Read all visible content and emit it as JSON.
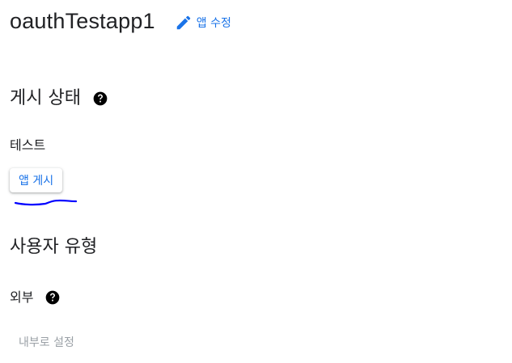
{
  "app": {
    "name": "oauthTestapp1",
    "edit_label": "앱 수정"
  },
  "publish_status": {
    "title": "게시 상태",
    "value": "테스트",
    "publish_button": "앱 게시"
  },
  "user_type": {
    "title": "사용자 유형",
    "value": "외부",
    "make_internal_button": "내부로 설정"
  },
  "colors": {
    "accent": "#1a73e8",
    "text": "#202124",
    "disabled": "#9aa0a6",
    "annotation": "#0000ff"
  },
  "icons": {
    "edit": "pencil-icon",
    "help": "help-circle-icon"
  }
}
